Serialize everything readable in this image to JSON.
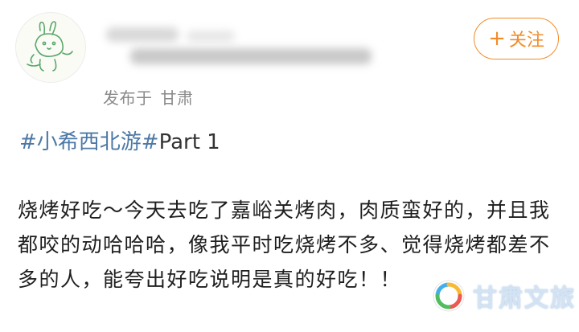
{
  "post": {
    "location_prefix": "发布于",
    "location": "甘肃",
    "follow_label": "关注",
    "follow_symbol": "+",
    "topic_tag": "#小希西北游#",
    "topic_suffix": "Part 1",
    "body": "烧烤好吃～今天去吃了嘉峪关烤肉，肉质蛮好的，并且我都咬的动哈哈哈，像我平时吃烧烤不多、觉得烧烤都差不多的人，能夸出好吃说明是真的好吃！！"
  },
  "watermark": {
    "text": "甘肃文旅"
  },
  "colors": {
    "accent": "#f28c28",
    "topic": "#4d79a6",
    "meta": "#8a8a8a",
    "verify_badge": "#f0b400"
  },
  "icons": {
    "avatar": "rabbit-doodle-avatar",
    "verify": "verified-badge-icon",
    "watermark_logo": "gansu-wenlv-logo-icon"
  }
}
